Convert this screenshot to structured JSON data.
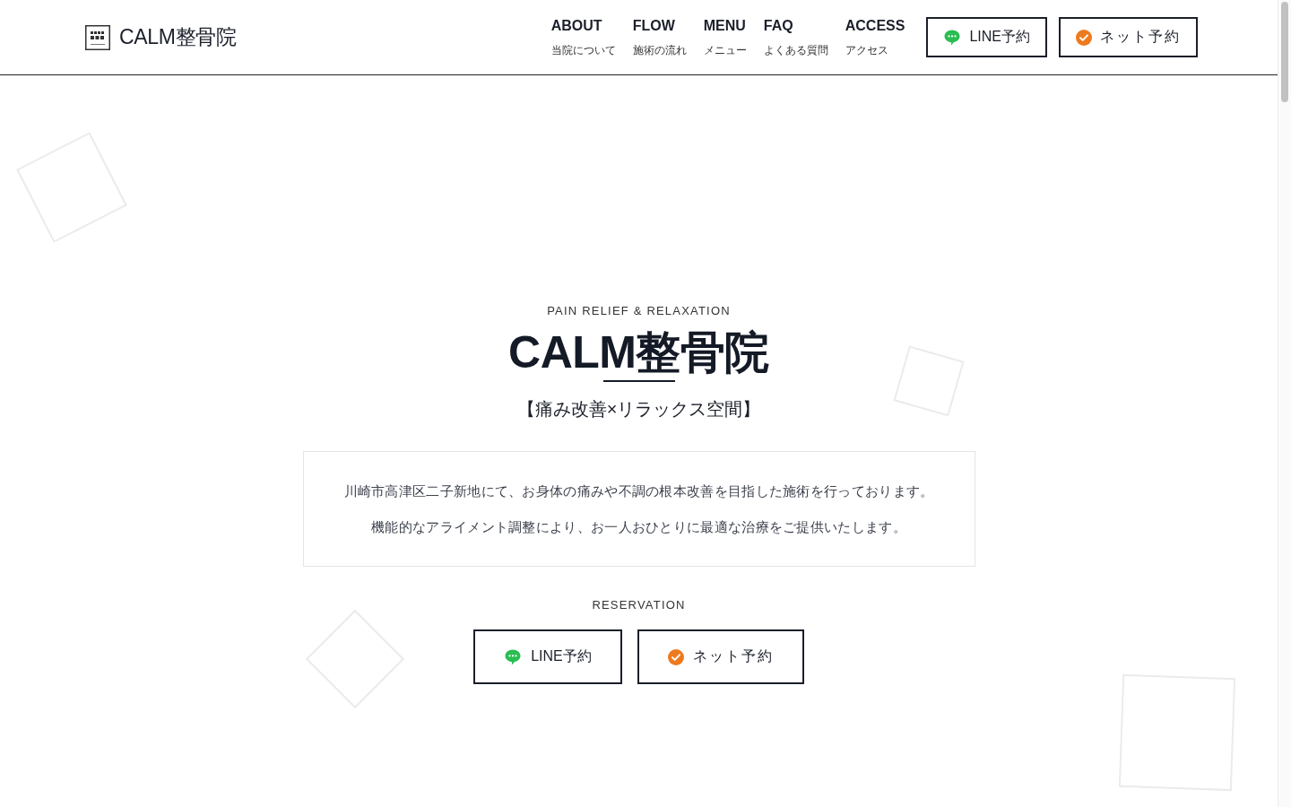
{
  "header": {
    "logo_text": "CALM整骨院",
    "nav": [
      {
        "label": "ABOUT",
        "sub": "当院について"
      },
      {
        "label": "FLOW",
        "sub": "施術の流れ"
      },
      {
        "label": "MENU",
        "sub": "メニュー"
      },
      {
        "label": "FAQ",
        "sub": "よくある質問"
      },
      {
        "label": "ACCESS",
        "sub": "アクセス"
      }
    ],
    "buttons": [
      {
        "kind": "line",
        "label": "LINE予約"
      },
      {
        "kind": "net",
        "label": "ネット予約"
      }
    ]
  },
  "hero": {
    "eyebrow": "PAIN RELIEF & RELAXATION",
    "title": "CALM整骨院",
    "subtitle": "【痛み改善×リラックス空間】",
    "description": [
      "川崎市高津区二子新地にて、お身体の痛みや不調の根本改善を目指した施術を行っております。",
      "機能的なアライメント調整により、お一人おひとりに最適な治療をご提供いたします。"
    ],
    "reservation": {
      "label": "RESERVATION",
      "buttons": [
        {
          "kind": "line",
          "label": "LINE予約"
        },
        {
          "kind": "net",
          "label": "ネット予約"
        }
      ]
    }
  }
}
